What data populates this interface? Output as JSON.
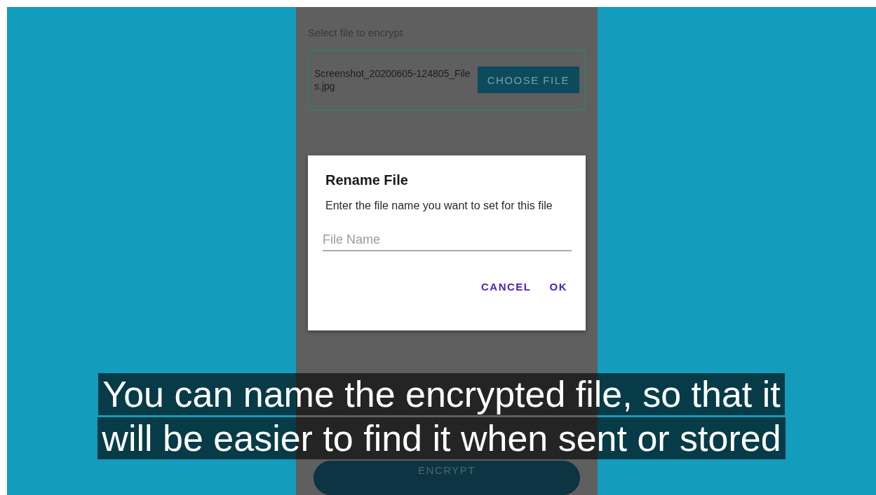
{
  "screen": {
    "select_label": "Select file to encrypt",
    "file_name": "Screenshot_20200605-124805_Files.jpg",
    "choose_button": "CHOOSE FILE",
    "encrypt_button": "ENCRYPT"
  },
  "dialog": {
    "title": "Rename File",
    "message": "Enter the file name you want to set for this file",
    "field": {
      "placeholder": "File Name"
    },
    "buttons": [
      "CANCEL",
      "OK"
    ]
  },
  "caption": [
    "You can name the encrypted file, so that it",
    "will be easier to find it when sent or stored"
  ]
}
